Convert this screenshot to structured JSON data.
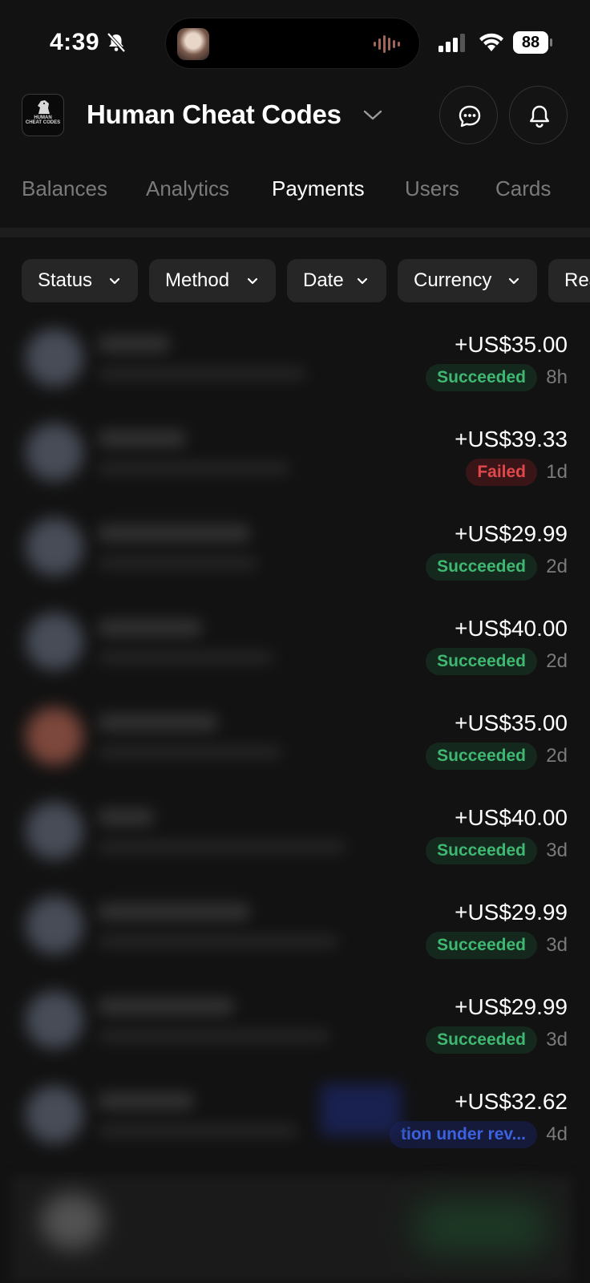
{
  "status_bar": {
    "time": "4:39",
    "battery": "88"
  },
  "header": {
    "logo_text_line1": "HUMAN",
    "logo_text_line2": "CHEAT CODES",
    "title": "Human Cheat Codes"
  },
  "tabs": [
    {
      "label": "Balances",
      "active": false
    },
    {
      "label": "Analytics",
      "active": false
    },
    {
      "label": "Payments",
      "active": true
    },
    {
      "label": "Users",
      "active": false
    },
    {
      "label": "Cards",
      "active": false
    }
  ],
  "filters": [
    {
      "label": "Status"
    },
    {
      "label": "Method"
    },
    {
      "label": "Date"
    },
    {
      "label": "Currency"
    },
    {
      "label": "Rea"
    }
  ],
  "payments": [
    {
      "amount": "+US$35.00",
      "status": "Succeeded",
      "status_type": "succeeded",
      "ago": "8h"
    },
    {
      "amount": "+US$39.33",
      "status": "Failed",
      "status_type": "failed",
      "ago": "1d"
    },
    {
      "amount": "+US$29.99",
      "status": "Succeeded",
      "status_type": "succeeded",
      "ago": "2d"
    },
    {
      "amount": "+US$40.00",
      "status": "Succeeded",
      "status_type": "succeeded",
      "ago": "2d"
    },
    {
      "amount": "+US$35.00",
      "status": "Succeeded",
      "status_type": "succeeded",
      "ago": "2d"
    },
    {
      "amount": "+US$40.00",
      "status": "Succeeded",
      "status_type": "succeeded",
      "ago": "3d"
    },
    {
      "amount": "+US$29.99",
      "status": "Succeeded",
      "status_type": "succeeded",
      "ago": "3d"
    },
    {
      "amount": "+US$29.99",
      "status": "Succeeded",
      "status_type": "succeeded",
      "ago": "3d"
    },
    {
      "amount": "+US$32.62",
      "status": "tion under rev...",
      "status_type": "review",
      "ago": "4d"
    }
  ],
  "colors": {
    "background": "#121212",
    "succeeded": "#3fb871",
    "failed": "#e0484c",
    "review": "#3d62e0"
  }
}
